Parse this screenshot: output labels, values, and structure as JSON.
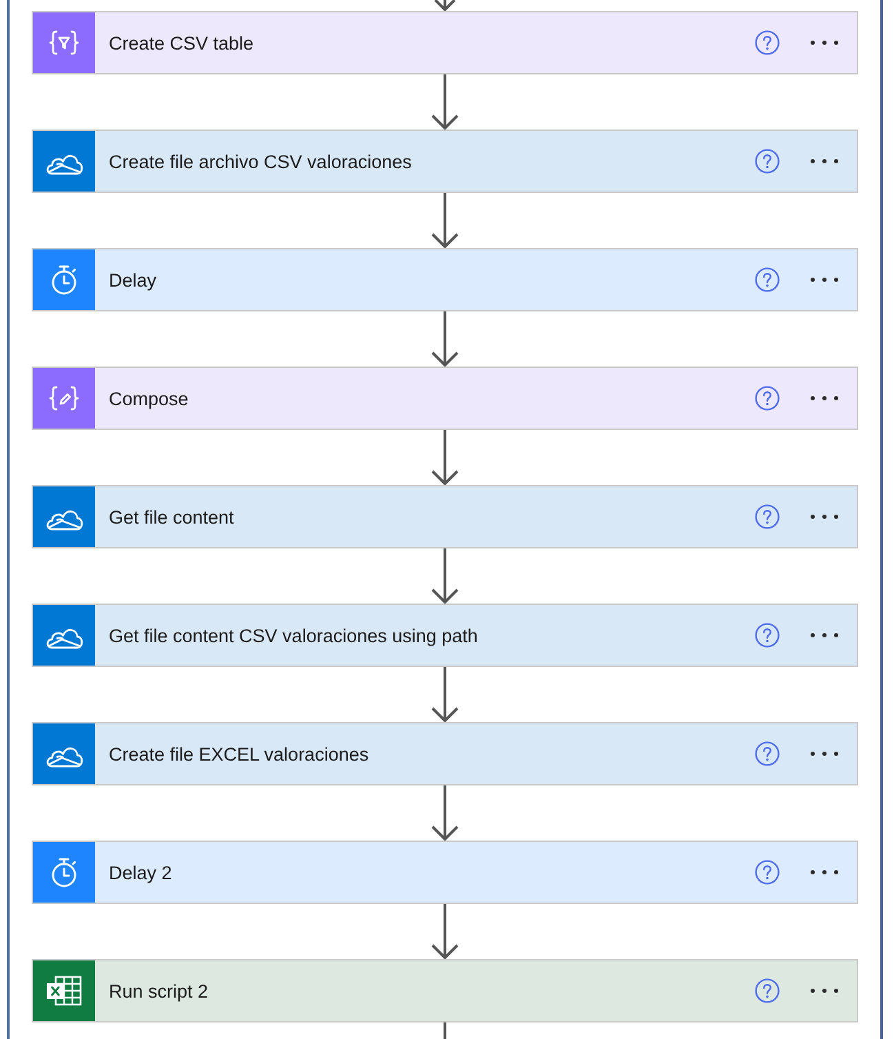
{
  "steps": [
    {
      "title": "Create CSV table",
      "kind": "table"
    },
    {
      "title": "Create file archivo CSV valoraciones",
      "kind": "cloud"
    },
    {
      "title": "Delay",
      "kind": "timer"
    },
    {
      "title": "Compose",
      "kind": "compose"
    },
    {
      "title": "Get file content",
      "kind": "cloud"
    },
    {
      "title": "Get file content CSV valoraciones using path",
      "kind": "cloud"
    },
    {
      "title": "Create file EXCEL valoraciones",
      "kind": "cloud"
    },
    {
      "title": "Delay 2",
      "kind": "timer"
    },
    {
      "title": "Run script 2",
      "kind": "excel"
    }
  ]
}
